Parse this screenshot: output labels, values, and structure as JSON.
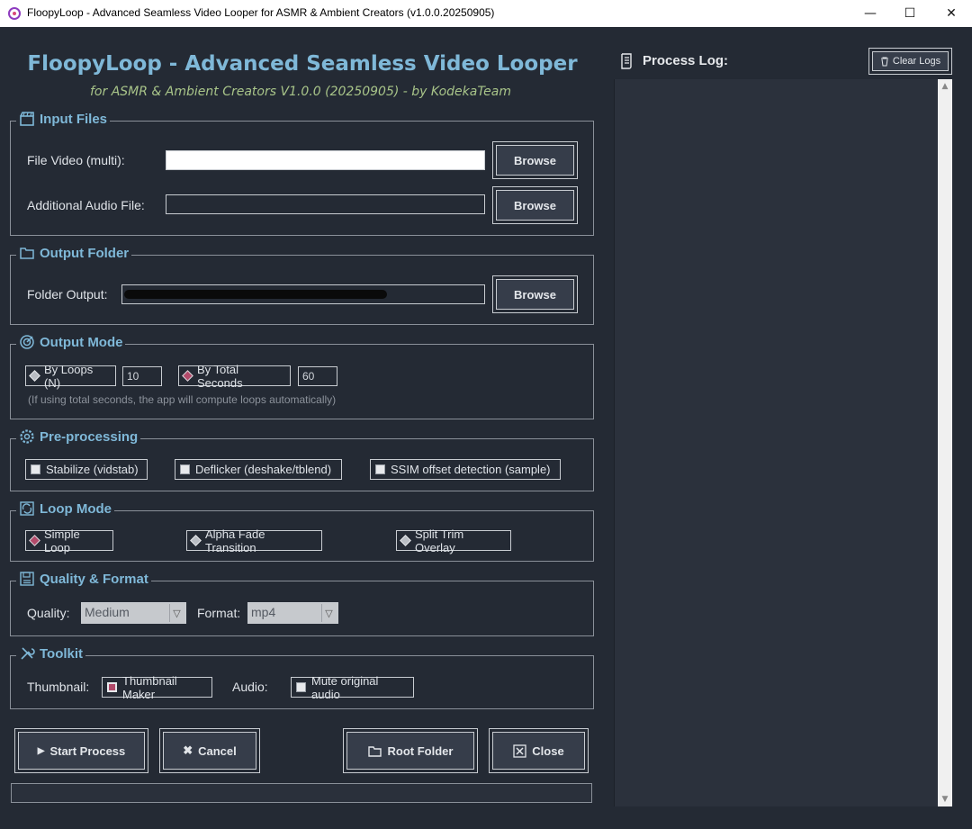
{
  "window": {
    "title": "FloopyLoop - Advanced Seamless Video Looper for ASMR & Ambient Creators (v1.0.0.20250905)",
    "minimize": "—",
    "maximize": "☐",
    "close": "✕"
  },
  "header": {
    "title": "FloopyLoop - Advanced Seamless Video Looper",
    "subtitle": "for ASMR & Ambient Creators V1.0.0 (20250905) - by KodekaTeam"
  },
  "input_files": {
    "title": "Input Files",
    "video_label": "File Video (multi):",
    "video_value": "",
    "audio_label": "Additional Audio File:",
    "audio_value": "",
    "browse": "Browse"
  },
  "output_folder": {
    "title": "Output Folder",
    "label": "Folder Output:",
    "browse": "Browse"
  },
  "output_mode": {
    "title": "Output Mode",
    "by_loops_label": "By Loops (N)",
    "by_loops_value": "10",
    "by_seconds_label": "By Total Seconds",
    "by_seconds_value": "60",
    "selected": "by_seconds",
    "note": "(If using total seconds, the app will compute loops automatically)"
  },
  "preprocessing": {
    "title": "Pre-processing",
    "stabilize": "Stabilize (vidstab)",
    "deflicker": "Deflicker (deshake/tblend)",
    "ssim": "SSIM offset detection (sample)"
  },
  "loop_mode": {
    "title": "Loop Mode",
    "simple": "Simple Loop",
    "alpha": "Alpha Fade Transition",
    "split": "Split Trim Overlay",
    "selected": "simple"
  },
  "quality_format": {
    "title": "Quality & Format",
    "quality_label": "Quality:",
    "quality_value": "Medium",
    "format_label": "Format:",
    "format_value": "mp4"
  },
  "toolkit": {
    "title": "Toolkit",
    "thumbnail_label": "Thumbnail:",
    "thumbnail_option": "Thumbnail Maker",
    "audio_label": "Audio:",
    "audio_option": "Mute original audio"
  },
  "actions": {
    "start": "Start Process",
    "cancel": "Cancel",
    "root": "Root Folder",
    "close": "Close"
  },
  "progress": 0,
  "log": {
    "title": "Process Log:",
    "clear": "Clear Logs"
  },
  "colors": {
    "background": "#242a34",
    "accent": "#7fb8d8",
    "subtitle": "#a8c489",
    "selected": "#b24a6a"
  }
}
